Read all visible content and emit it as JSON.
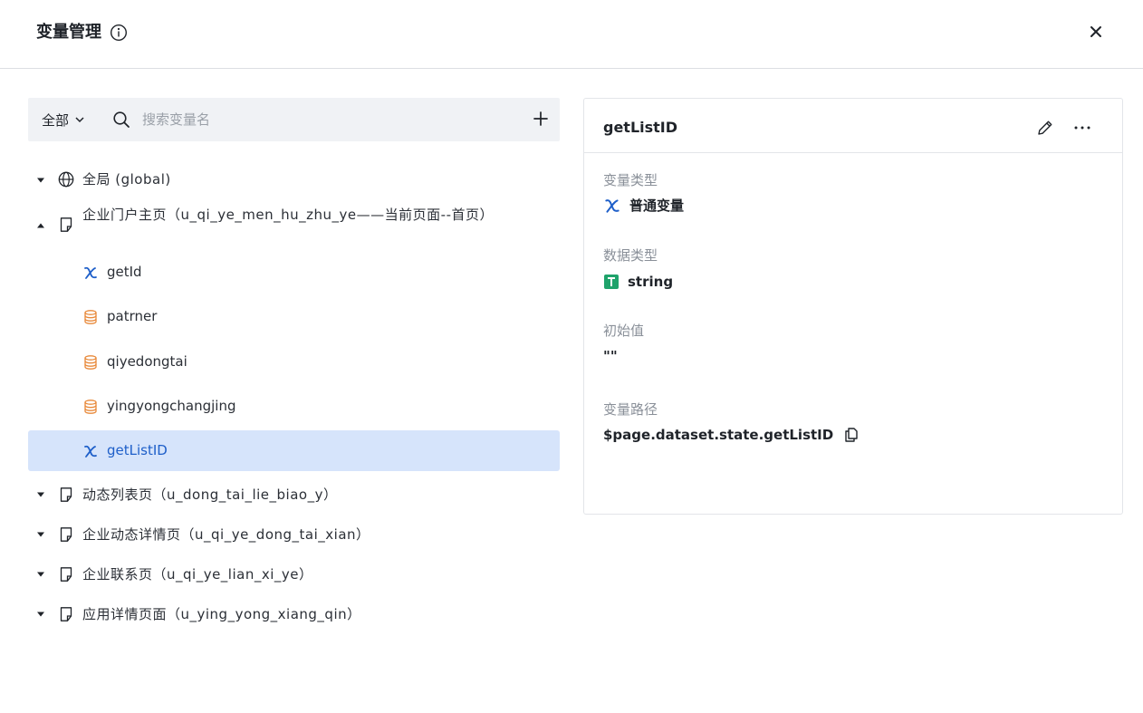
{
  "dialog": {
    "title": "变量管理",
    "info_icon": "info-circle-icon",
    "close_icon": "close-icon"
  },
  "toolbar": {
    "scope_label": "全部",
    "search_placeholder": "搜索变量名",
    "search_value": "",
    "add_icon": "plus-icon"
  },
  "tree": {
    "global_label": "全局 (global)",
    "current_page_label": "企业门户主页（u_qi_ye_men_hu_zhu_ye——当前页面--首页）",
    "variables": [
      {
        "name": "getId",
        "icon": "variable-icon"
      },
      {
        "name": "patrner",
        "icon": "dataset-icon"
      },
      {
        "name": "qiyedongtai",
        "icon": "dataset-icon"
      },
      {
        "name": "yingyongchangjing",
        "icon": "dataset-icon"
      },
      {
        "name": "getListID",
        "icon": "variable-icon",
        "selected": true
      }
    ],
    "pages": [
      "动态列表页（u_dong_tai_lie_biao_y）",
      "企业动态详情页（u_qi_ye_dong_tai_xian）",
      "企业联系页（u_qi_ye_lian_xi_ye）",
      "应用详情页面（u_ying_yong_xiang_qin）"
    ]
  },
  "detail": {
    "title": "getListID",
    "variable_type_label": "变量类型",
    "variable_type_value": "普通变量",
    "data_type_label": "数据类型",
    "data_type_value": "string",
    "initial_value_label": "初始值",
    "initial_value": "\"\"",
    "path_label": "变量路径",
    "path_value": "$page.dataset.state.getListID"
  },
  "colors": {
    "selected_bg": "#d6e4fb",
    "accent_blue": "#1e5fc9",
    "dataset_orange": "#e8893a",
    "string_green": "#1fa36b"
  }
}
